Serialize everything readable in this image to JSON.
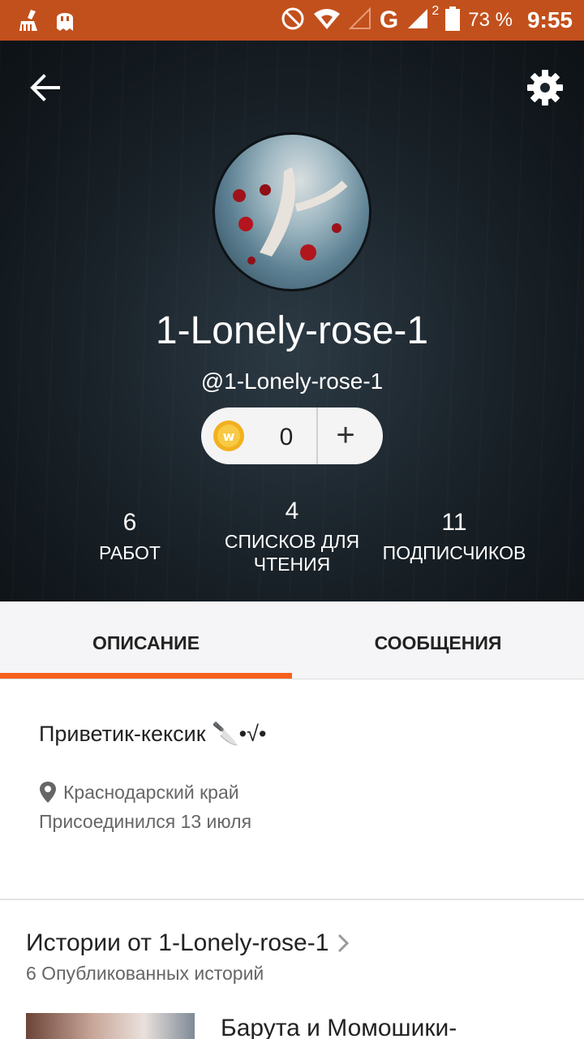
{
  "status_bar": {
    "icons_left": [
      "broom-icon",
      "ghost-icon"
    ],
    "icons_right": [
      "do-not-disturb-icon",
      "wifi-icon",
      "signal-icon",
      "signal-2-icon",
      "battery-icon"
    ],
    "network": "G",
    "network_sup": "2",
    "battery": "73 %",
    "time": "9:55"
  },
  "header": {
    "back_icon": "arrow-left-icon",
    "settings_icon": "gear-icon",
    "display_name": "1-Lonely-rose-1",
    "username": "@1-Lonely-rose-1",
    "coins": {
      "count": "0",
      "add": "+"
    },
    "stats": [
      {
        "value": "6",
        "label": "РАБОТ"
      },
      {
        "value": "4",
        "label": "СПИСКОВ ДЛЯ ЧТЕНИЯ"
      },
      {
        "value": "11",
        "label": "ПОДПИСЧИКОВ"
      }
    ]
  },
  "tabs": [
    {
      "label": "ОПИСАНИЕ",
      "active": true
    },
    {
      "label": "СООБЩЕНИЯ",
      "active": false
    }
  ],
  "about": {
    "text": "Приветик-кексик 🔪•√•",
    "location": "Краснодарский край",
    "joined": "Присоединился 13 июля"
  },
  "stories": {
    "title": "Истории от 1-Lonely-rose-1",
    "count": "6 Опубликованных историй",
    "first_story_title": "Барута и Момошики-"
  },
  "colors": {
    "status_bar": "#c2501c",
    "accent": "#f5611d",
    "tab_bg": "#f5f4f6",
    "coin": "#f2b01e"
  }
}
